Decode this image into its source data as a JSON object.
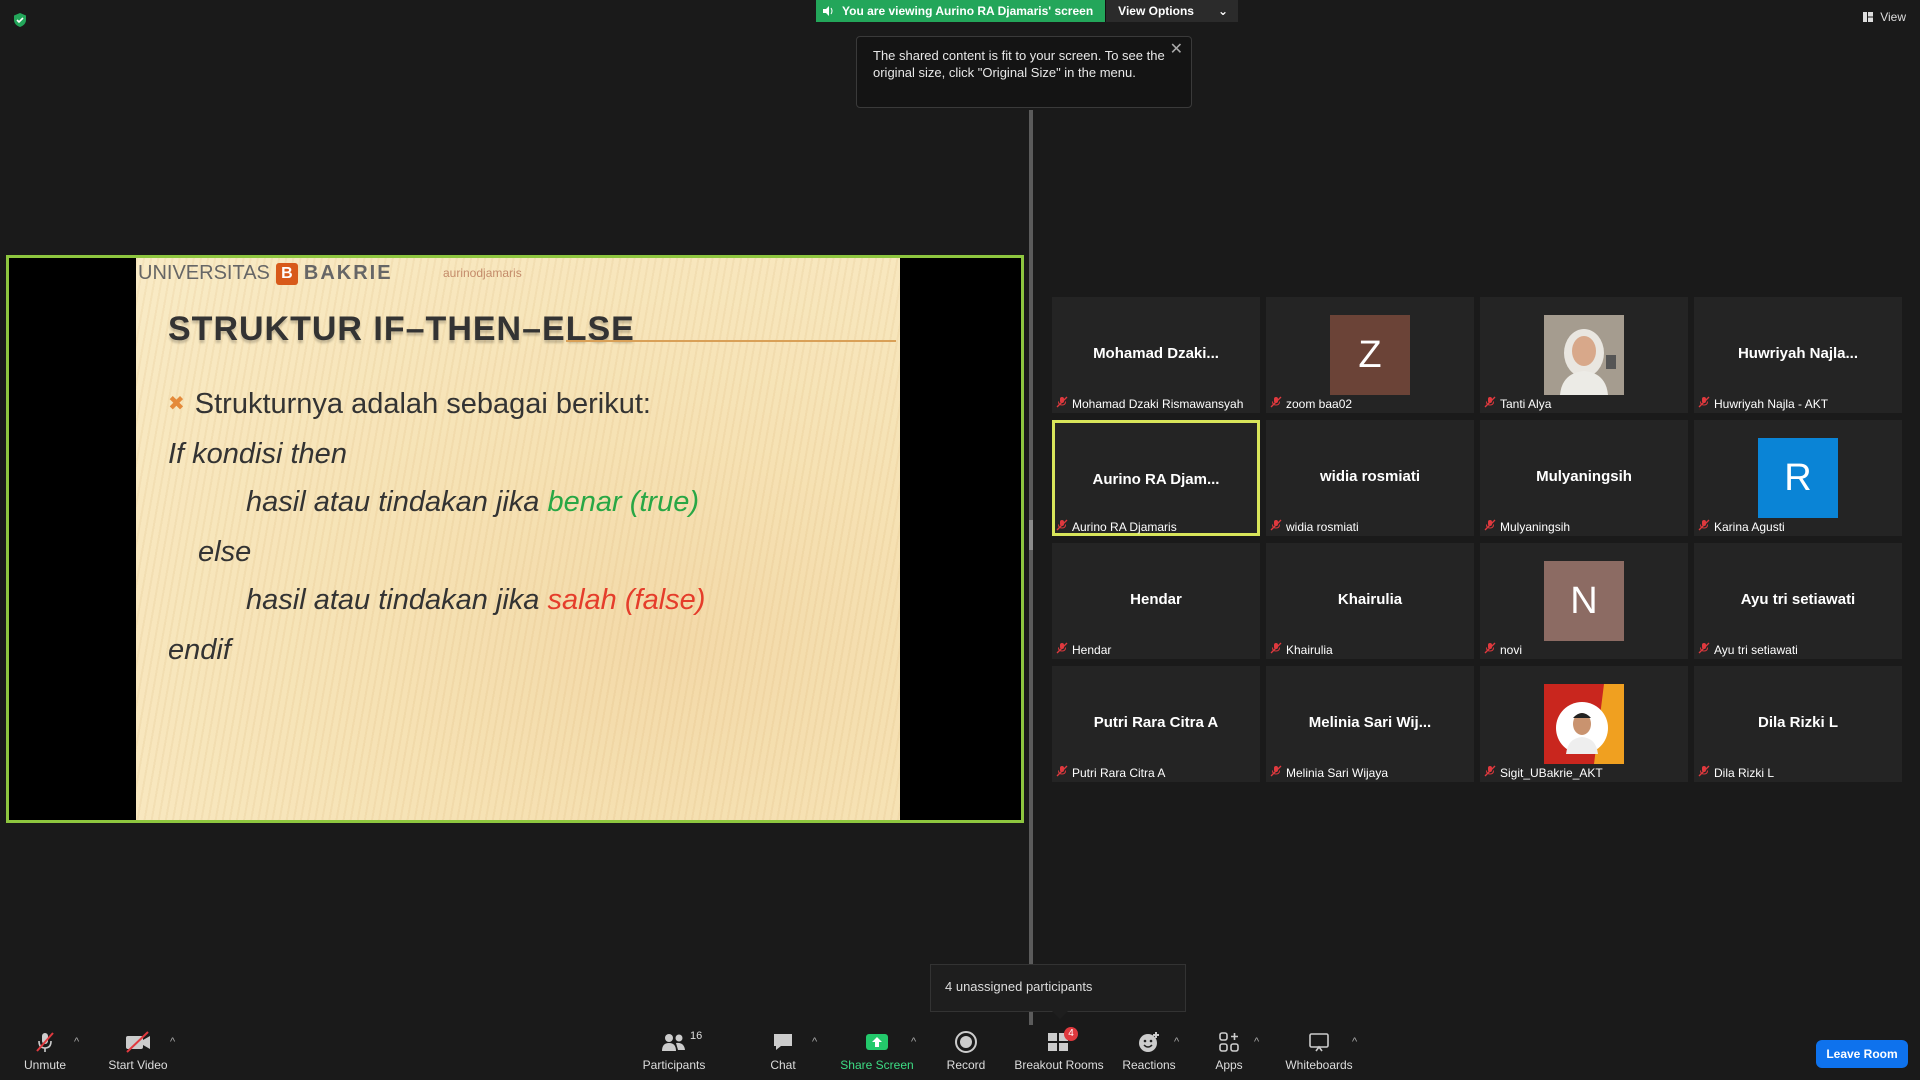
{
  "banner": {
    "viewing_text": "You are viewing Aurino RA Djamaris' screen",
    "view_options_label": "View Options"
  },
  "view_button_label": "View",
  "tooltip": {
    "text": "The shared content is fit to your screen. To see the original size, click \"Original Size\" in the menu."
  },
  "slide": {
    "logo_left": "UNIVERSITAS",
    "logo_letter": "B",
    "logo_right": "BAKRIE",
    "watermark": "aurinodjamaris",
    "title": "STRUKTUR IF–THEN–ELSE",
    "line1": "Strukturnya adalah sebagai berikut:",
    "line2": "If kondisi then",
    "line3_a": "hasil atau tindakan jika ",
    "line3_b": "benar (true)",
    "line4": "else",
    "line5_a": "hasil atau tindakan jika ",
    "line5_b": "salah (false)",
    "line6": "endif",
    "true_color": "#28a745",
    "false_color": "#e53d2b"
  },
  "participants": [
    {
      "big": "Mohamad  Dzaki...",
      "label": "Mohamad Dzaki Rismawansyah"
    },
    {
      "avatar_letter": "Z",
      "avatar_color": "#6b4337",
      "label": "zoom baa02"
    },
    {
      "photo": "woman-hijab-photo",
      "label": "Tanti Alya"
    },
    {
      "big": "Huwriyah  Najla...",
      "label": "Huwriyah Najla - AKT"
    },
    {
      "big": "Aurino  RA  Djam...",
      "label": "Aurino RA Djamaris",
      "active": true
    },
    {
      "big": "widia rosmiati",
      "label": "widia rosmiati"
    },
    {
      "big": "Mulyaningsih",
      "label": "Mulyaningsih"
    },
    {
      "avatar_letter": "R",
      "avatar_color": "#0a84d6",
      "label": "Karina Agusti"
    },
    {
      "big": "Hendar",
      "label": "Hendar"
    },
    {
      "big": "Khairulia",
      "label": "Khairulia"
    },
    {
      "avatar_letter": "N",
      "avatar_color": "#8c6b63",
      "label": "novi"
    },
    {
      "big": "Ayu tri setiawati",
      "label": "Ayu tri setiawati"
    },
    {
      "big": "Putri Rara Citra A",
      "label": "Putri Rara Citra A"
    },
    {
      "big": "Melinia  Sari  Wij...",
      "label": "Melinia Sari Wijaya"
    },
    {
      "photo": "man-portrait-photo",
      "label": "Sigit_UBakrie_AKT"
    },
    {
      "big": "Dila Rizki L",
      "label": "Dila Rizki L"
    }
  ],
  "notification": {
    "text": "4 unassigned participants"
  },
  "toolbar": {
    "unmute": "Unmute",
    "start_video": "Start Video",
    "participants": "Participants",
    "participants_count": "16",
    "chat": "Chat",
    "share_screen": "Share Screen",
    "record": "Record",
    "breakout_rooms": "Breakout Rooms",
    "breakout_badge": "4",
    "reactions": "Reactions",
    "apps": "Apps",
    "whiteboards": "Whiteboards",
    "leave": "Leave Room"
  },
  "colors": {
    "accent_green": "#23a65a",
    "active_border": "#d8e55a",
    "share_border": "#8ec63f",
    "leave_blue": "#0e72ed",
    "mute_red": "#e0393e"
  }
}
